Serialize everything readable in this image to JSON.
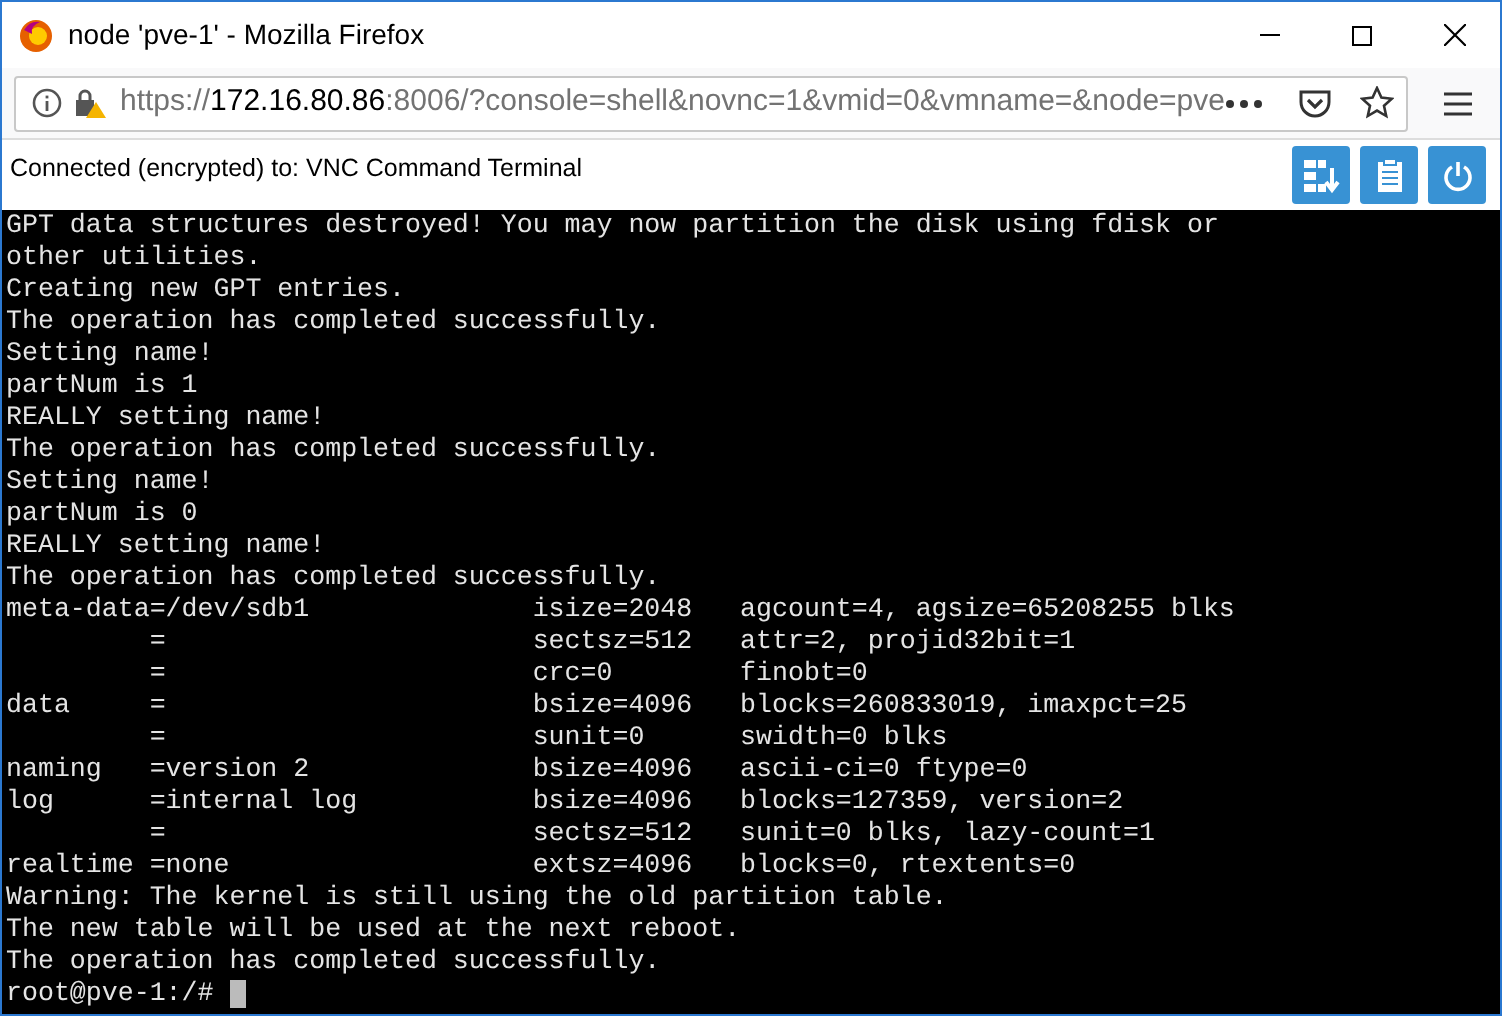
{
  "window": {
    "title": "node 'pve-1' - Mozilla Firefox"
  },
  "address_bar": {
    "scheme": "https://",
    "host": "172.16.80.86",
    "rest": ":8006/?console=shell&novnc=1&vmid=0&vmname=&node=pve"
  },
  "vnc_bar": {
    "status": "Connected (encrypted) to: VNC Command Terminal"
  },
  "terminal": {
    "lines": [
      "GPT data structures destroyed! You may now partition the disk using fdisk or",
      "other utilities.",
      "Creating new GPT entries.",
      "The operation has completed successfully.",
      "Setting name!",
      "partNum is 1",
      "REALLY setting name!",
      "The operation has completed successfully.",
      "Setting name!",
      "partNum is 0",
      "REALLY setting name!",
      "The operation has completed successfully.",
      "meta-data=/dev/sdb1              isize=2048   agcount=4, agsize=65208255 blks",
      "         =                       sectsz=512   attr=2, projid32bit=1",
      "         =                       crc=0        finobt=0",
      "data     =                       bsize=4096   blocks=260833019, imaxpct=25",
      "         =                       sunit=0      swidth=0 blks",
      "naming   =version 2              bsize=4096   ascii-ci=0 ftype=0",
      "log      =internal log           bsize=4096   blocks=127359, version=2",
      "         =                       sectsz=512   sunit=0 blks, lazy-count=1",
      "realtime =none                   extsz=4096   blocks=0, rtextents=0",
      "Warning: The kernel is still using the old partition table.",
      "The new table will be used at the next reboot.",
      "The operation has completed successfully."
    ],
    "prompt": "root@pve-1:/#"
  }
}
